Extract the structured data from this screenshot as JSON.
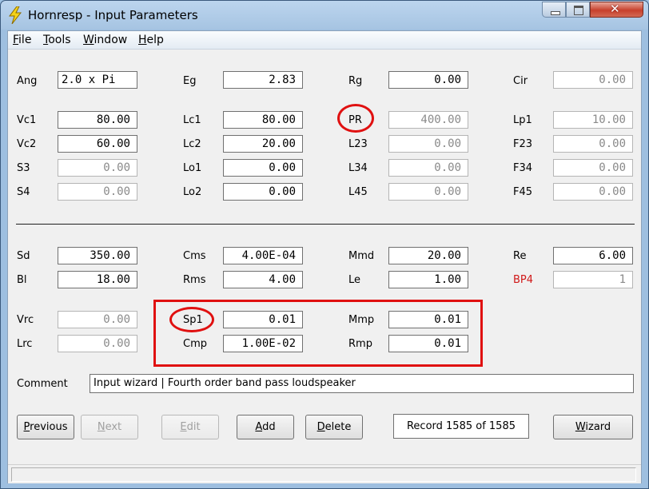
{
  "window": {
    "title": "Hornresp - Input Parameters",
    "close_glyph": "✕"
  },
  "menu": [
    {
      "label": "File",
      "accel": "F",
      "rest": "ile"
    },
    {
      "label": "Tools",
      "accel": "T",
      "rest": "ools"
    },
    {
      "label": "Window",
      "accel": "W",
      "rest": "indow"
    },
    {
      "label": "Help",
      "accel": "H",
      "rest": "elp"
    }
  ],
  "params": {
    "ang": {
      "label": "Ang",
      "value": "2.0 x Pi"
    },
    "eg": {
      "label": "Eg",
      "value": "2.83"
    },
    "rg": {
      "label": "Rg",
      "value": "0.00"
    },
    "cir": {
      "label": "Cir",
      "value": "0.00"
    },
    "vc1": {
      "label": "Vc1",
      "value": "80.00"
    },
    "lc1": {
      "label": "Lc1",
      "value": "80.00"
    },
    "pr": {
      "label": "PR",
      "value": "400.00"
    },
    "lp1": {
      "label": "Lp1",
      "value": "10.00"
    },
    "vc2": {
      "label": "Vc2",
      "value": "60.00"
    },
    "lc2": {
      "label": "Lc2",
      "value": "20.00"
    },
    "l23": {
      "label": "L23",
      "value": "0.00"
    },
    "f23": {
      "label": "F23",
      "value": "0.00"
    },
    "s3": {
      "label": "S3",
      "value": "0.00"
    },
    "lo1": {
      "label": "Lo1",
      "value": "0.00"
    },
    "l34": {
      "label": "L34",
      "value": "0.00"
    },
    "f34": {
      "label": "F34",
      "value": "0.00"
    },
    "s4": {
      "label": "S4",
      "value": "0.00"
    },
    "lo2": {
      "label": "Lo2",
      "value": "0.00"
    },
    "l45": {
      "label": "L45",
      "value": "0.00"
    },
    "f45": {
      "label": "F45",
      "value": "0.00"
    },
    "sd": {
      "label": "Sd",
      "value": "350.00"
    },
    "cms": {
      "label": "Cms",
      "value": "4.00E-04"
    },
    "mmd": {
      "label": "Mmd",
      "value": "20.00"
    },
    "re": {
      "label": "Re",
      "value": "6.00"
    },
    "bl": {
      "label": "Bl",
      "value": "18.00"
    },
    "rms": {
      "label": "Rms",
      "value": "4.00"
    },
    "le": {
      "label": "Le",
      "value": "1.00"
    },
    "bp4": {
      "label": "BP4",
      "value": "1"
    },
    "vrc": {
      "label": "Vrc",
      "value": "0.00"
    },
    "sp1": {
      "label": "Sp1",
      "value": "0.01"
    },
    "mmp": {
      "label": "Mmp",
      "value": "0.01"
    },
    "lrc": {
      "label": "Lrc",
      "value": "0.00"
    },
    "cmp": {
      "label": "Cmp",
      "value": "1.00E-02"
    },
    "rmp": {
      "label": "Rmp",
      "value": "0.01"
    }
  },
  "comment": {
    "label": "Comment",
    "value": "Input wizard | Fourth order band pass loudspeaker"
  },
  "buttons": {
    "previous": {
      "accel": "P",
      "rest": "revious"
    },
    "next": {
      "accel": "N",
      "rest": "ext"
    },
    "edit": {
      "accel": "E",
      "rest": "dit"
    },
    "add": {
      "accel": "A",
      "rest": "dd"
    },
    "delete": {
      "accel": "D",
      "rest": "elete"
    },
    "wizard": {
      "accel": "W",
      "rest": "izard"
    }
  },
  "record": "Record 1585 of 1585",
  "colors": {
    "annotation_red": "#e01010",
    "bp4_label": "#d01818",
    "disabled_text": "#8a8a8a"
  }
}
